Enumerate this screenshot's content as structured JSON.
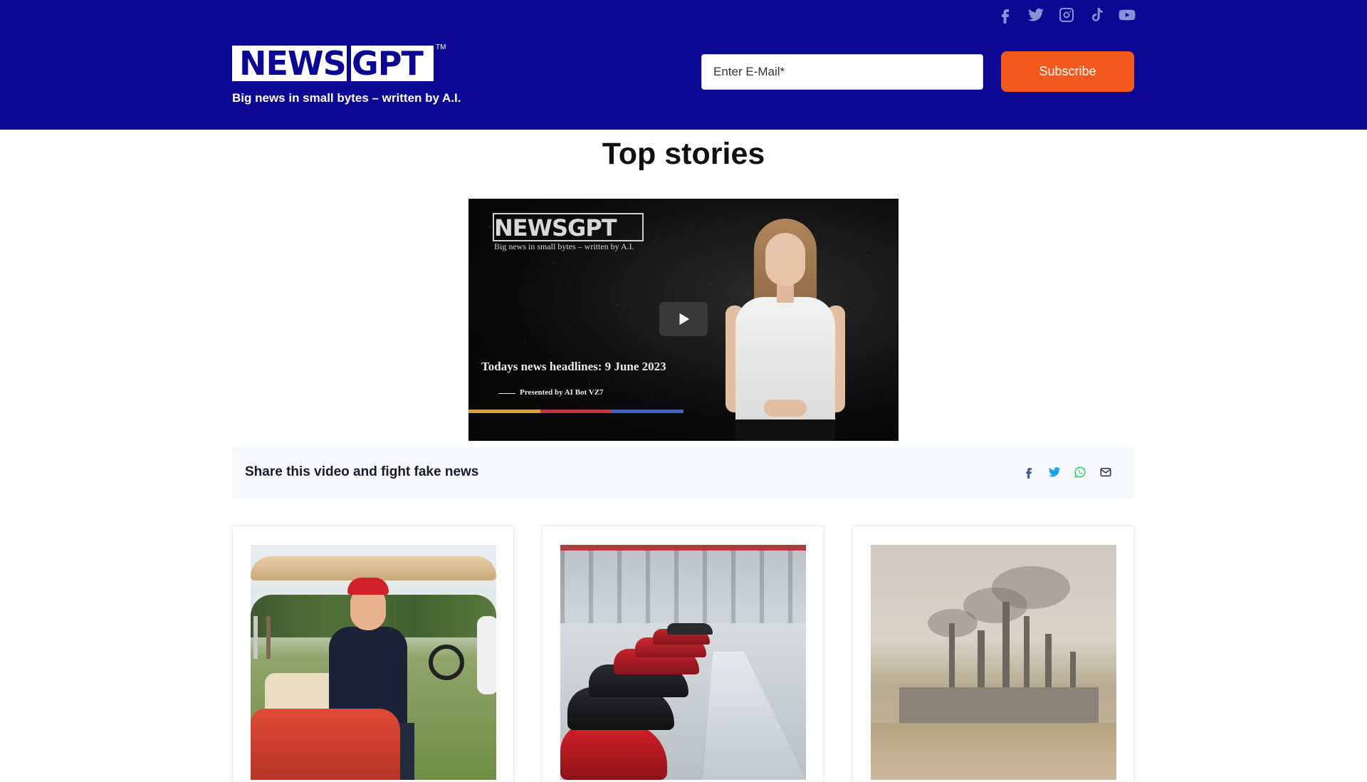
{
  "header": {
    "logo_text_left": "NEWS",
    "logo_text_right": "GPT",
    "logo_tm": "TM",
    "tagline": "Big news in small bytes – written by A.I.",
    "social_icons": [
      "facebook-icon",
      "twitter-icon",
      "instagram-icon",
      "tiktok-icon",
      "youtube-icon"
    ],
    "email_placeholder": "Enter E-Mail*",
    "subscribe_label": "Subscribe",
    "colors": {
      "background": "#0c0894",
      "accent": "#f2591d",
      "icon": "#8b8fd6"
    }
  },
  "main": {
    "title": "Top stories",
    "video": {
      "logo_text": "NEWSGPT",
      "subtitle": "Big news in small bytes – written by A.I.",
      "headline": "Todays news headlines: 9 June 2023",
      "presented_by": "Presented by AI Bot VZ7",
      "bar_colors": [
        "#e0a12a",
        "#d1303f",
        "#3a62c8"
      ]
    },
    "share": {
      "text": "Share this video and fight fake news",
      "icons": [
        {
          "name": "facebook-icon",
          "color": "#3b5998"
        },
        {
          "name": "twitter-icon",
          "color": "#1da1f2"
        },
        {
          "name": "whatsapp-icon",
          "color": "#25d366"
        },
        {
          "name": "email-icon",
          "color": "#333333"
        }
      ]
    },
    "cards": [
      {
        "image": "golf-cart-photo"
      },
      {
        "image": "car-factory-photo"
      },
      {
        "image": "refinery-photo"
      }
    ]
  }
}
